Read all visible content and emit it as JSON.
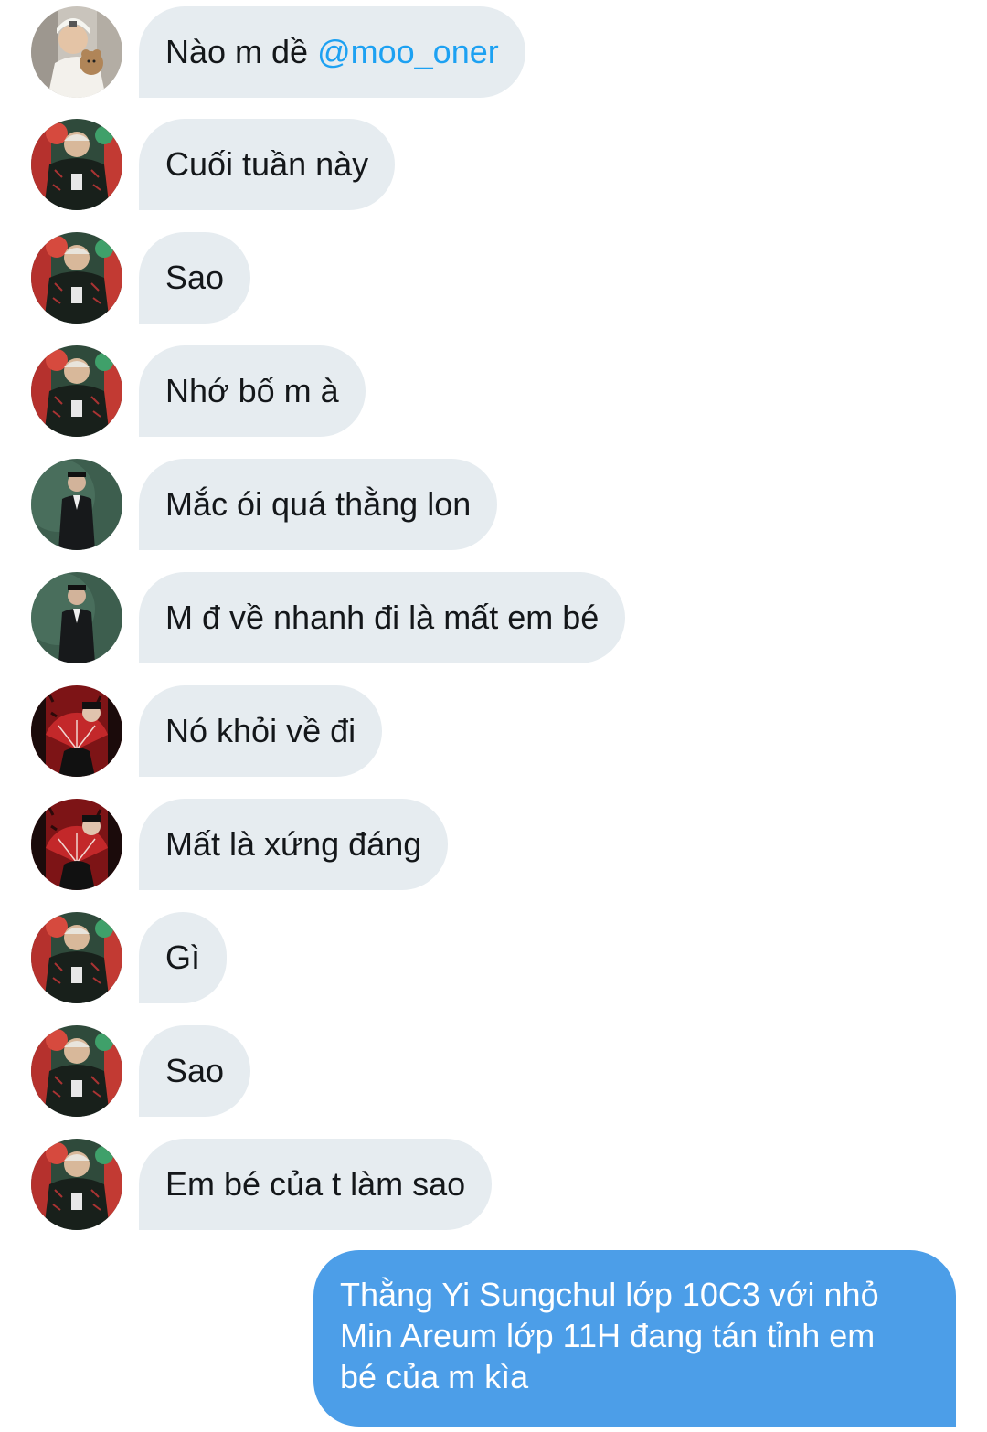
{
  "conversation": {
    "messages": [
      {
        "avatar": "user-mittens-avatar",
        "text": "Nào m dề ",
        "mention": "@moo_oner"
      },
      {
        "avatar": "user-jersey-avatar",
        "text": "Cuối tuần này"
      },
      {
        "avatar": "user-jersey-avatar",
        "text": "Sao"
      },
      {
        "avatar": "user-jersey-avatar",
        "text": "Nhớ bố m à"
      },
      {
        "avatar": "user-suit-avatar",
        "text": "Mắc ói quá thằng lon"
      },
      {
        "avatar": "user-suit-avatar",
        "text": "M đ về nhanh đi là mất em bé"
      },
      {
        "avatar": "user-redfan-avatar",
        "text": "Nó khỏi về đi"
      },
      {
        "avatar": "user-redfan-avatar",
        "text": "Mất là xứng đáng"
      },
      {
        "avatar": "user-jersey-avatar",
        "text": "Gì"
      },
      {
        "avatar": "user-jersey-avatar",
        "text": "Sao"
      },
      {
        "avatar": "user-jersey-avatar",
        "text": "Em bé của t làm sao"
      }
    ],
    "sent_message": {
      "lines": [
        "Thằng Yi Sungchul lớp 10C3 với nhỏ",
        "Min Areum lớp 11H đang tán tỉnh em",
        "bé của m kìa"
      ]
    }
  },
  "colors": {
    "received_bubble": "#e6ecf0",
    "received_text": "#14171a",
    "sent_bubble": "#4c9ee8",
    "sent_text": "#ffffff",
    "mention": "#1da1f2"
  }
}
